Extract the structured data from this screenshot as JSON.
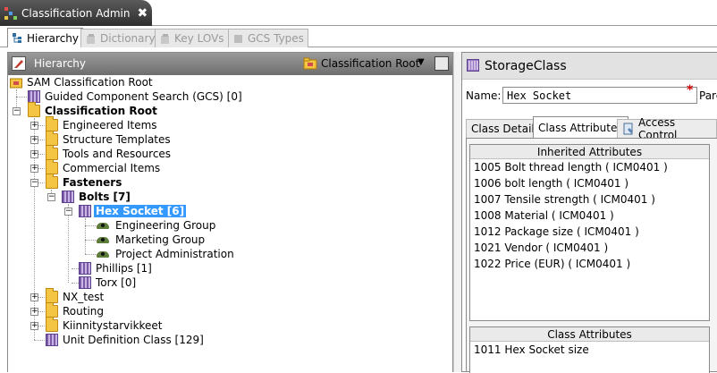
{
  "window": {
    "title": "Classification Admin",
    "close_glyph": "✖"
  },
  "tabs": [
    {
      "label": "Hierarchy",
      "active": true
    },
    {
      "label": "Dictionary",
      "active": false
    },
    {
      "label": "Key LOVs",
      "active": false
    },
    {
      "label": "GCS Types",
      "active": false
    }
  ],
  "hierarchy_panel": {
    "title": "Hierarchy",
    "root_selector": "Classification Root"
  },
  "tree": [
    {
      "label": "SAM Classification Root",
      "icon": "root-folder-icon"
    },
    {
      "label": "Guided Component Search (GCS)  [0]",
      "icon": "class-icon"
    },
    {
      "label": "Classification Root",
      "icon": "folder-icon",
      "bold": true
    },
    {
      "label": "Engineered Items",
      "icon": "folder-icon"
    },
    {
      "label": "Structure Templates",
      "icon": "folder-icon"
    },
    {
      "label": "Tools and Resources",
      "icon": "folder-icon"
    },
    {
      "label": "Commercial Items",
      "icon": "folder-icon"
    },
    {
      "label": "Fasteners",
      "icon": "folder-icon",
      "bold": true
    },
    {
      "label": "Bolts  [7]",
      "icon": "class-icon",
      "bold": true
    },
    {
      "label": "Hex Socket  [6]",
      "icon": "class-icon",
      "selected": true
    },
    {
      "label": "Engineering Group",
      "icon": "group-icon"
    },
    {
      "label": "Marketing Group",
      "icon": "group-icon"
    },
    {
      "label": "Project Administration",
      "icon": "group-icon"
    },
    {
      "label": "Phillips  [1]",
      "icon": "class-icon"
    },
    {
      "label": "Torx  [0]",
      "icon": "class-icon"
    },
    {
      "label": "NX_test",
      "icon": "folder-icon"
    },
    {
      "label": "Routing",
      "icon": "folder-icon"
    },
    {
      "label": "Kiinnitystarvikkeet",
      "icon": "folder-icon"
    },
    {
      "label": "Unit Definition Class  [129]",
      "icon": "class-icon"
    }
  ],
  "detail": {
    "title": "StorageClass",
    "name_label": "Name:",
    "name_value": "Hex Socket",
    "required_marker": "*",
    "parent_label_fragment": "Pare",
    "tabs": [
      {
        "label": "Class Details",
        "active": false
      },
      {
        "label": "Class Attributes",
        "active": true
      },
      {
        "label": "Access Control",
        "active": false
      }
    ],
    "inherited_header": "Inherited Attributes",
    "inherited": [
      "1005  Bolt thread length  ( ICM0401 )",
      "1006  bolt length  ( ICM0401 )",
      "1007  Tensile strength  ( ICM0401 )",
      "1008  Material  ( ICM0401 )",
      "1012  Package size  ( ICM0401 )",
      "1021  Vendor  ( ICM0401 )",
      "1022  Price (EUR)  ( ICM0401 )"
    ],
    "class_header": "Class Attributes",
    "class_attrs": [
      "1011  Hex Socket size"
    ]
  },
  "colors": {
    "selection": "#3399ff",
    "title_tab": "#3a3a3a",
    "folder": "#f4c542",
    "class": "#7b5aa6",
    "required": "#d00000"
  }
}
